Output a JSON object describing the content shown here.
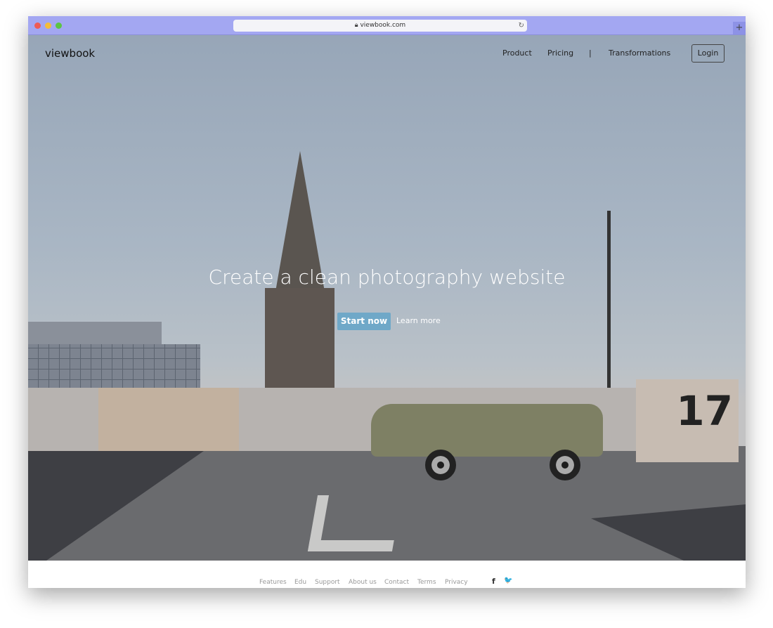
{
  "browser": {
    "url": "viewbook.com",
    "new_tab": "+"
  },
  "nav": {
    "logo": "viewbook",
    "links": [
      "Product",
      "Pricing",
      "|",
      "Transformations"
    ],
    "login": "Login"
  },
  "hero": {
    "headline": "Create a clean photography website",
    "start": "Start now",
    "learn": "Learn more",
    "sign_number": "17"
  },
  "footer": {
    "links": [
      "Features",
      "Edu",
      "Support",
      "About us",
      "Contact",
      "Terms",
      "Privacy"
    ],
    "social": [
      "f",
      "🐦"
    ]
  }
}
